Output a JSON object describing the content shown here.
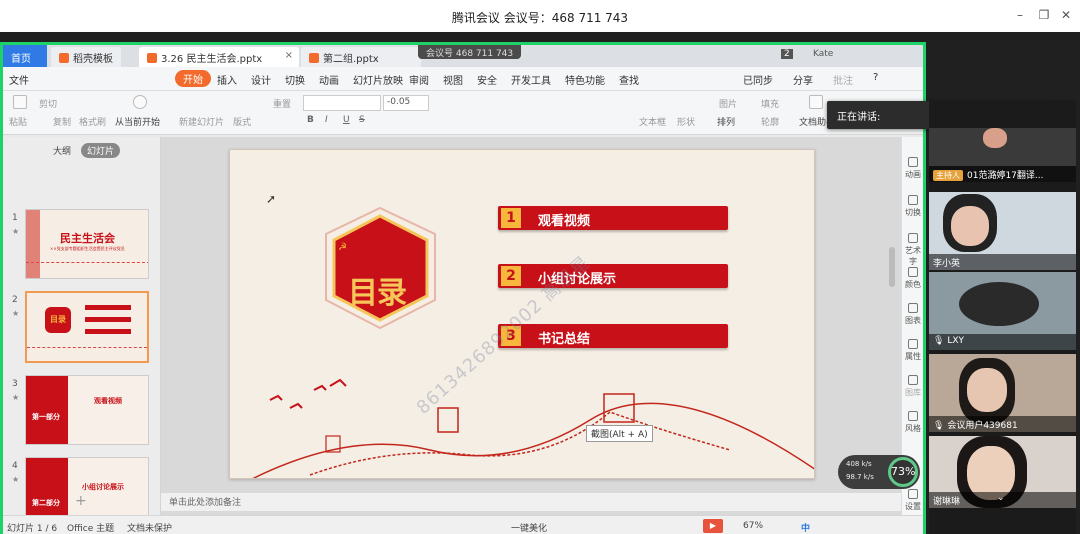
{
  "window": {
    "title": "腾讯会议  会议号：468 711 743",
    "minimize": "–",
    "restore": "❐",
    "close": "✕"
  },
  "meeting_pill": "会议号 468 711 743",
  "tabs": [
    {
      "label": "首页"
    },
    {
      "label": "稻壳模板"
    },
    {
      "label": "3.26 民主生活会.pptx",
      "active": true
    },
    {
      "label": "第二组.pptx"
    }
  ],
  "tab_close": "×",
  "tab_add": "+",
  "user": {
    "badge": "2",
    "name": "Kate"
  },
  "menu": [
    "文件",
    "开始",
    "插入",
    "设计",
    "切换",
    "动画",
    "幻灯片放映",
    "审阅",
    "视图",
    "安全",
    "开发工具",
    "特色功能",
    "查找"
  ],
  "menu_right": {
    "sync": "已同步",
    "share": "分享",
    "comment": "批注",
    "help": "?"
  },
  "ribbon": {
    "paste": "粘贴",
    "cut": "剪切",
    "copy": "复制",
    "format_painter": "格式刷",
    "play_from_current": "从当前开始",
    "new_slide": "新建幻灯片",
    "layout": "版式",
    "reset": "重置",
    "font_size": "-0.05",
    "bold": "B",
    "italic": "I",
    "underline": "U",
    "strike": "S",
    "textbox": "文本框",
    "shape": "形状",
    "arrange": "排列",
    "outline": "轮廓",
    "picture": "图片",
    "fill": "填充",
    "doc_assistant": "文档助手"
  },
  "left_pane": {
    "tab_outline": "大纲",
    "tab_slides": "幻灯片",
    "slides": [
      {
        "num": "1",
        "title": "民主生活会",
        "sub": "××党支部专题组织生活会暨民主评议党员"
      },
      {
        "num": "2",
        "title": "目录"
      },
      {
        "num": "3",
        "part": "第一部分",
        "title": "观看视频"
      },
      {
        "num": "4",
        "part": "第二部分",
        "title": "小组讨论展示"
      }
    ],
    "add": "+"
  },
  "slide": {
    "emblem_text": "目录",
    "items": [
      {
        "num": "1",
        "text": "观看视频"
      },
      {
        "num": "2",
        "text": "小组讨论展示"
      },
      {
        "num": "3",
        "text": "书记总结"
      }
    ],
    "watermark": "8613426892002 高恩星",
    "tooltip": "截图(Alt + A)"
  },
  "right_bar": [
    "动画",
    "切换",
    "艺术字",
    "颜色",
    "图表",
    "属性",
    "图库",
    "风格",
    "设置"
  ],
  "notes_placeholder": "单击此处添加备注",
  "status": {
    "slide_count": "幻灯片 1 / 6",
    "theme": "Office 主题",
    "protect": "文档未保护",
    "beautify": "一键美化",
    "zoom": "67%",
    "ime": "中"
  },
  "net": {
    "up": "408 k/s",
    "down": "98.7 k/s",
    "percent": "73%"
  },
  "speaking": {
    "label": "正在讲话:"
  },
  "participants": [
    {
      "name": "01范潞婷17翻译...",
      "host": "主持人"
    },
    {
      "name": "李小英"
    },
    {
      "name": "LXY"
    },
    {
      "name": "会议用户439681"
    },
    {
      "name": "谢琳琳"
    }
  ],
  "colors": {
    "accent": "#f26a2c",
    "brand_red": "#c81018",
    "border_green": "#1fd267"
  }
}
